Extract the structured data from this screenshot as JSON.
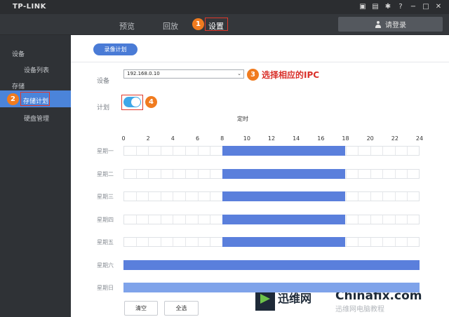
{
  "titlebar": {
    "brand": "TP-LINK",
    "icons": [
      "save-icon",
      "layout-icon",
      "gear-icon",
      "help-icon",
      "minimize-icon",
      "maximize-icon",
      "close-icon"
    ]
  },
  "nav": {
    "tabs": [
      {
        "label": "预览"
      },
      {
        "label": "回放"
      },
      {
        "label": "设置"
      }
    ],
    "active_tab": "设置",
    "login_label": "请登录"
  },
  "sidebar": {
    "group_device": "设备",
    "item_device_list": "设备列表",
    "group_storage": "存储",
    "item_storage_plan": "存储计划",
    "item_disk_manage": "硬盘管理"
  },
  "annotations": {
    "b1": "1",
    "b2": "2",
    "b3": "3",
    "b4": "4",
    "select_ipc": "选择相应的IPC"
  },
  "main": {
    "record_plan_button": "录像计划",
    "device_label": "设备",
    "device_value": "192.168.0.10",
    "plan_label": "计划",
    "plan_enabled": true,
    "schedule_title": "定时",
    "hours": [
      "0",
      "2",
      "4",
      "6",
      "8",
      "10",
      "12",
      "14",
      "16",
      "18",
      "20",
      "22",
      "24"
    ],
    "days": [
      {
        "label": "星期一",
        "start": 8,
        "end": 18
      },
      {
        "label": "星期二",
        "start": 8,
        "end": 18
      },
      {
        "label": "星期三",
        "start": 8,
        "end": 18
      },
      {
        "label": "星期四",
        "start": 8,
        "end": 18
      },
      {
        "label": "星期五",
        "start": 8,
        "end": 18
      },
      {
        "label": "星期六",
        "start": 0,
        "end": 24
      },
      {
        "label": "星期日",
        "start": 0,
        "end": 24
      }
    ],
    "clear_button": "清空",
    "select_all_button": "全选"
  },
  "watermark": {
    "cn_text": "迅维网",
    "en_text": "Chinafix.com",
    "ghost_text": "迅维网电脑教程"
  },
  "colors": {
    "accent": "#4b84da",
    "fill_weekday": "#5a7fdc",
    "fill_sunday": "#7fa3ea",
    "annotation": "#e0392b",
    "badge": "#f07b1f"
  }
}
